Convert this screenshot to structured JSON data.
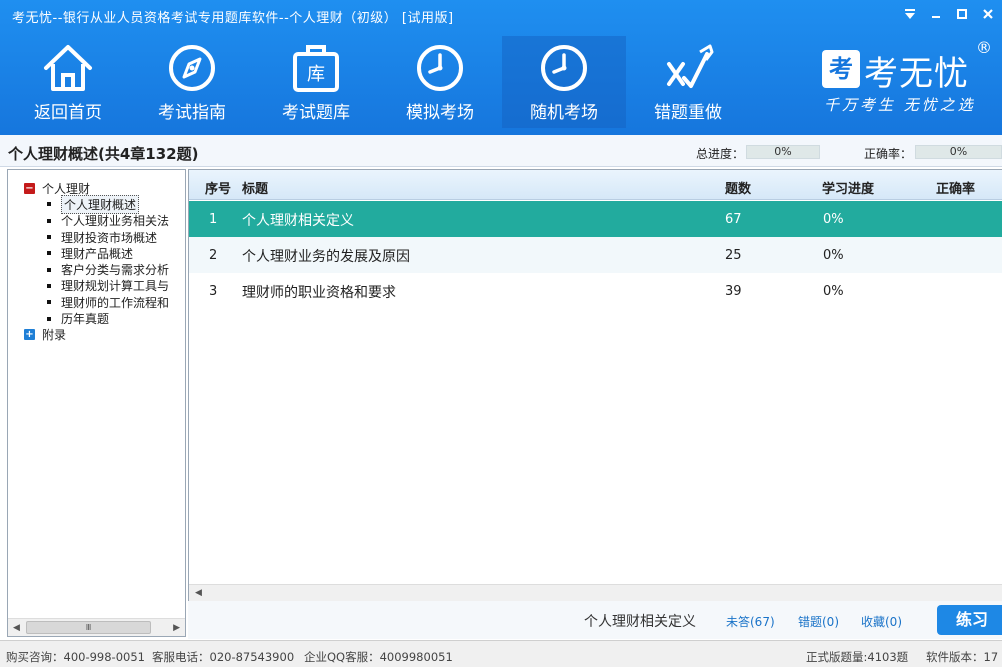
{
  "window": {
    "title": "考无忧--银行从业人员资格考试专用题库软件--个人理财（初级）  [试用版]"
  },
  "toolbar": {
    "items": [
      {
        "label": "返回首页",
        "icon": "home-icon"
      },
      {
        "label": "考试指南",
        "icon": "compass-icon"
      },
      {
        "label": "考试题库",
        "icon": "question-bank-icon"
      },
      {
        "label": "模拟考场",
        "icon": "clock-icon"
      },
      {
        "label": "随机考场",
        "icon": "clock-icon"
      },
      {
        "label": "错题重做",
        "icon": "wrong-answer-redo-icon"
      }
    ],
    "active_index": 4
  },
  "brand": {
    "logo_char": "考",
    "name": "考无忧",
    "registered": "®",
    "slogan": "千万考生  无忧之选"
  },
  "section": {
    "title": "个人理财概述(共4章132题)",
    "total_progress_label": "总进度：",
    "total_progress_value": "0%",
    "accuracy_label": "正确率：",
    "accuracy_value": "0%"
  },
  "tree": {
    "root": "个人理财",
    "children": [
      "个人理财概述",
      "个人理财业务相关法",
      "理财投资市场概述",
      "理财产品概述",
      "客户分类与需求分析",
      "理财规划计算工具与",
      "理财师的工作流程和",
      "历年真题"
    ],
    "selected_index": 0,
    "appendix": "附录"
  },
  "table": {
    "headers": {
      "index": "序号",
      "title": "标题",
      "count": "题数",
      "progress": "学习进度",
      "accuracy": "正确率"
    },
    "rows": [
      {
        "index": "1",
        "title": "个人理财相关定义",
        "count": "67",
        "progress": "0%"
      },
      {
        "index": "2",
        "title": "个人理财业务的发展及原因",
        "count": "25",
        "progress": "0%"
      },
      {
        "index": "3",
        "title": "理财师的职业资格和要求",
        "count": "39",
        "progress": "0%"
      }
    ],
    "selected_row": 0
  },
  "actionbar": {
    "current": "个人理财相关定义",
    "unanswered": "未答(67)",
    "wrong": "错题(0)",
    "favorites": "收藏(0)",
    "practice": "练习"
  },
  "status": {
    "purchase": "购买咨询：400-998-0051",
    "service_phone": "客服电话：020-87543900",
    "qq": "企业QQ客服：4009980051",
    "full_count": "正式版题量:4103题",
    "version": "软件版本：17"
  },
  "colors": {
    "header_blue": "#1676dd",
    "selected_row": "#22ab9e",
    "practice_button": "#1e88e5"
  }
}
